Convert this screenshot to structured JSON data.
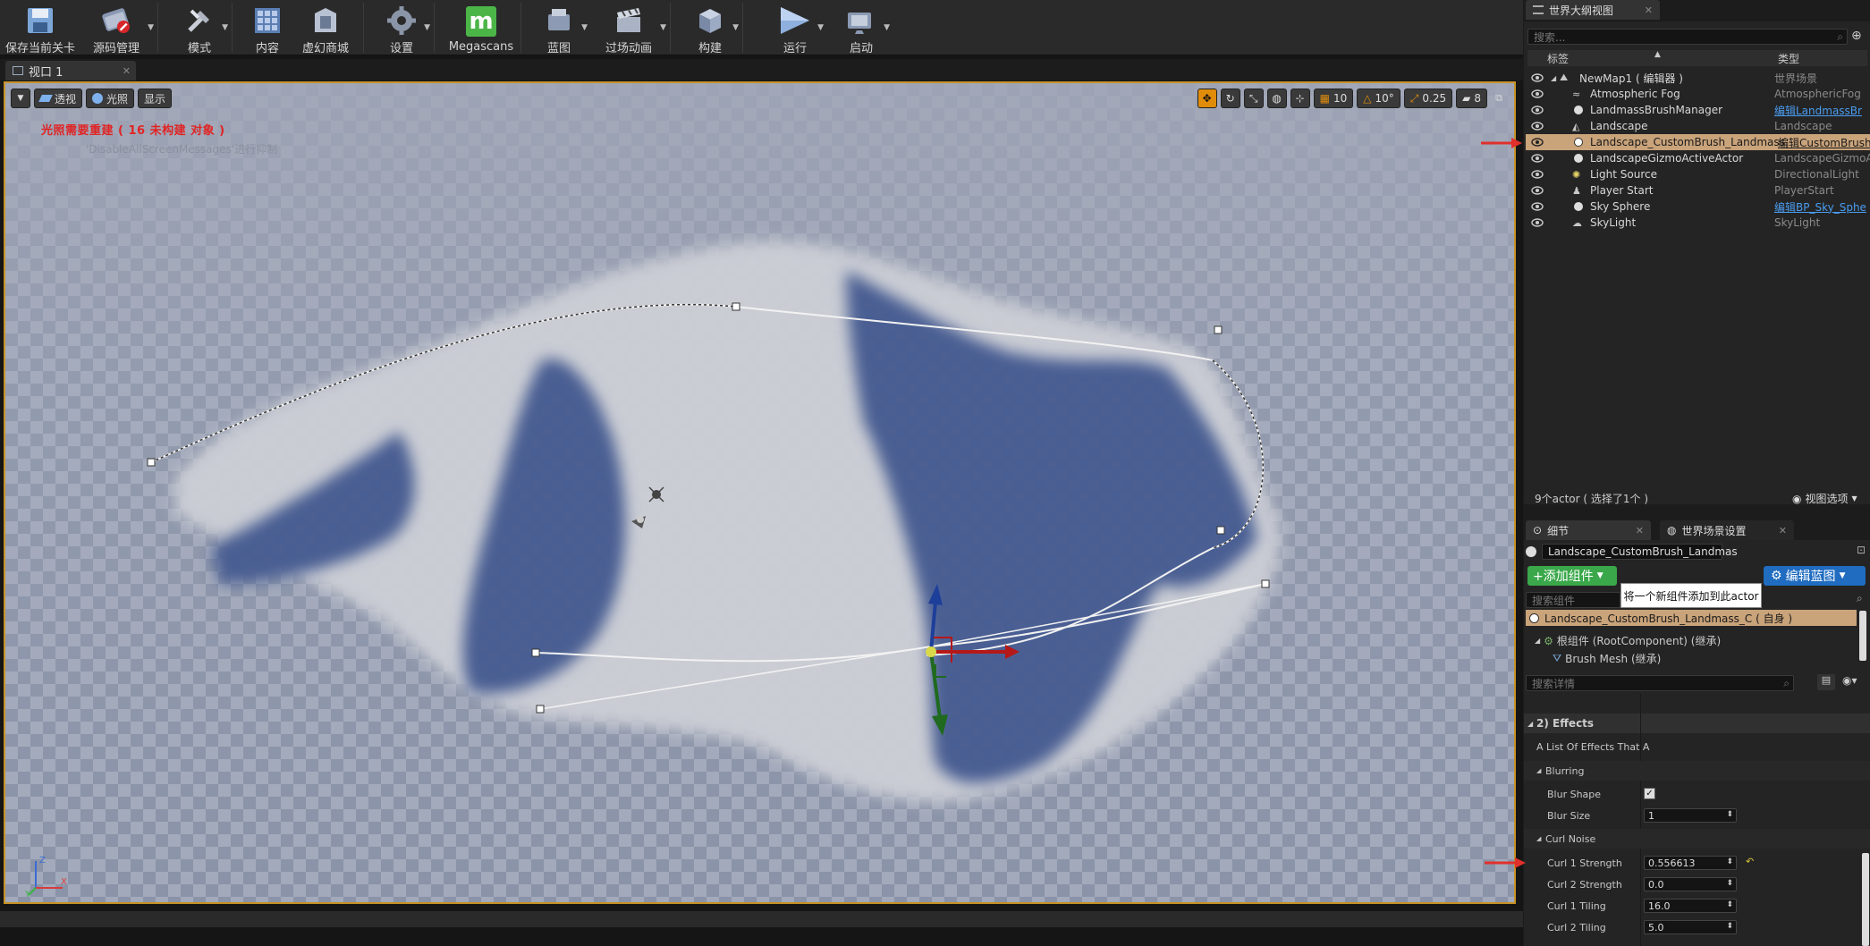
{
  "toolbar": {
    "items": [
      {
        "label": "保存当前关卡",
        "icon": "save-icon"
      },
      {
        "label": "源码管理",
        "icon": "source-control-icon"
      },
      {
        "label": "模式",
        "icon": "modes-icon"
      },
      {
        "label": "内容",
        "icon": "content-icon"
      },
      {
        "label": "虚幻商城",
        "icon": "marketplace-icon"
      },
      {
        "label": "设置",
        "icon": "settings-icon"
      },
      {
        "label": "Megascans",
        "icon": "megascans-icon"
      },
      {
        "label": "蓝图",
        "icon": "blueprint-icon"
      },
      {
        "label": "过场动画",
        "icon": "cinematics-icon"
      },
      {
        "label": "构建",
        "icon": "build-icon"
      },
      {
        "label": "运行",
        "icon": "play-icon"
      },
      {
        "label": "启动",
        "icon": "launch-icon"
      }
    ],
    "megascans_glyph": "m"
  },
  "viewport": {
    "tab_label": "视口 1",
    "perspective_label": "透视",
    "lit_label": "光照",
    "show_label": "显示",
    "grid_snap_value": "10",
    "rotation_snap_value": "10°",
    "scale_snap_value": "0.25",
    "camera_speed_value": "8",
    "warning_text": "光照需要重建 ( 16 未构建 对象 )",
    "suppress_hint": "'DisableAllScreenMessages'进行抑制"
  },
  "outliner": {
    "tab_label": "世界大纲视图",
    "search_placeholder": "搜索...",
    "col_label": "标签",
    "col_type": "类型",
    "rows": [
      {
        "name": "NewMap1 ( 编辑器 )",
        "type": "世界场景",
        "link": false
      },
      {
        "name": "Atmospheric Fog",
        "type": "AtmosphericFog",
        "link": false
      },
      {
        "name": "LandmassBrushManager",
        "type": "编辑LandmassBr",
        "link": true
      },
      {
        "name": "Landscape",
        "type": "Landscape",
        "link": false
      },
      {
        "name": "Landscape_CustomBrush_Landmass_",
        "type": "编辑CustomBrush",
        "link": true
      },
      {
        "name": "LandscapeGizmoActiveActor",
        "type": "LandscapeGizmoA",
        "link": false
      },
      {
        "name": "Light Source",
        "type": "DirectionalLight",
        "link": false
      },
      {
        "name": "Player Start",
        "type": "PlayerStart",
        "link": false
      },
      {
        "name": "Sky Sphere",
        "type": "编辑BP_Sky_Sphe",
        "link": true
      },
      {
        "name": "SkyLight",
        "type": "SkyLight",
        "link": false
      }
    ],
    "actor_count": "9个actor ( 选择了1个 )",
    "view_options": "视图选项"
  },
  "details": {
    "tab_label": "细节",
    "tab2_label": "世界场景设置",
    "actor_name": "Landscape_CustomBrush_Landmas",
    "add_component": "+添加组件",
    "edit_blueprint": "编辑蓝图",
    "tooltip": "将一个新组件添加到此actor",
    "search_components_placeholder": "搜索组件",
    "component_self": "Landscape_CustomBrush_Landmass_C ( 自身 )",
    "component_root": "根组件 (RootComponent) (继承)",
    "component_brush": "Brush Mesh (继承)",
    "search_details_placeholder": "搜索详情",
    "category_effects": "2) Effects",
    "effects_desc": "A List Of Effects That A",
    "blurring_label": "Blurring",
    "blur_shape_label": "Blur Shape",
    "blur_size_label": "Blur Size",
    "blur_size_value": "1",
    "curl_noise_label": "Curl Noise",
    "curl1_strength_label": "Curl 1 Strength",
    "curl1_strength_value": "0.556613",
    "curl2_strength_label": "Curl 2 Strength",
    "curl2_strength_value": "0.0",
    "curl1_tiling_label": "Curl 1 Tiling",
    "curl1_tiling_value": "16.0",
    "curl2_tiling_label": "Curl 2 Tiling",
    "curl2_tiling_value": "5.0"
  },
  "colors": {
    "accent_orange": "#e08c0b",
    "selection": "#c9a37a",
    "warning_red": "#e02424",
    "green_button": "#3aa84a",
    "blue_button": "#1f6cc0",
    "link_blue": "#4a9cf0"
  }
}
